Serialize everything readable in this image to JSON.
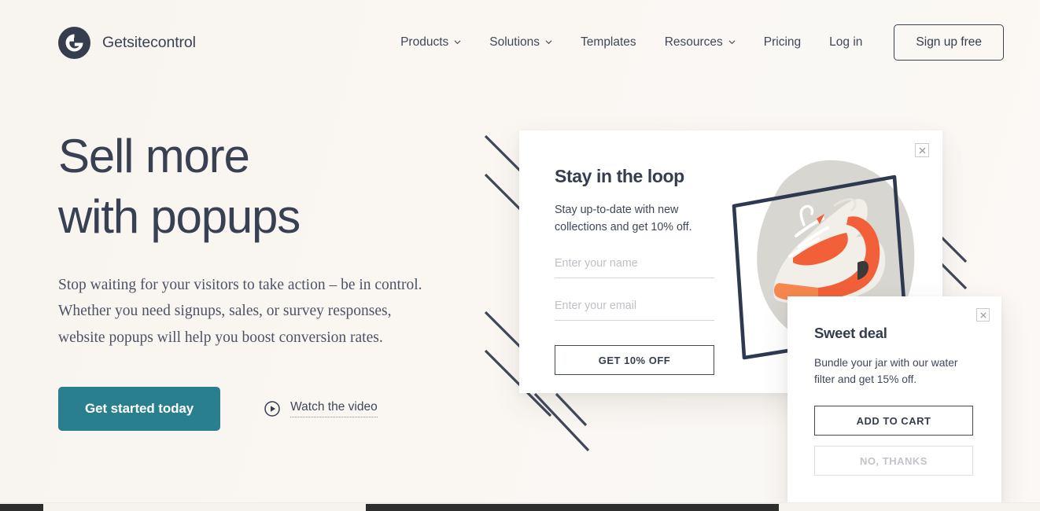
{
  "brand": {
    "name": "Getsitecontrol",
    "logo_icon": "getsitecontrol-g-logo"
  },
  "nav": {
    "items": [
      {
        "label": "Products",
        "has_caret": true
      },
      {
        "label": "Solutions",
        "has_caret": true
      },
      {
        "label": "Templates",
        "has_caret": false
      },
      {
        "label": "Resources",
        "has_caret": true
      },
      {
        "label": "Pricing",
        "has_caret": false
      },
      {
        "label": "Log in",
        "has_caret": false
      }
    ],
    "signup_label": "Sign up free"
  },
  "hero": {
    "headline_line1": "Sell more",
    "headline_line2": "with popups",
    "subtext_line1": "Stop waiting for your visitors to take action – be in control.",
    "subtext_line2": "Whether you need signups, sales, or survey responses,",
    "subtext_line3": "website popups will help you boost conversion rates.",
    "cta_label": "Get started today",
    "video_label": "Watch the video",
    "video_icon": "play-circle-icon",
    "cta_color": "#2a7f8f"
  },
  "popup1": {
    "title": "Stay in the loop",
    "desc_line1": "Stay up-to-date with new",
    "desc_line2": "collections and get 10% off.",
    "name_placeholder": "Enter your name",
    "name_value": "",
    "email_placeholder": "Enter your email",
    "email_value": "",
    "button_label": "GET 10% OFF",
    "close_icon": "close-icon",
    "image_alt": "white and orange sneaker"
  },
  "popup2": {
    "title": "Sweet deal",
    "desc_line1": "Bundle your jar with our water",
    "desc_line2": "filter and get 15% off.",
    "primary_label": "ADD TO CART",
    "secondary_label": "NO, THANKS",
    "close_icon": "close-icon"
  },
  "theme": {
    "background": "#faf6f2",
    "ink": "#353d4e",
    "accent_teal": "#2a7f8f",
    "decor_line": "#3f4759"
  }
}
